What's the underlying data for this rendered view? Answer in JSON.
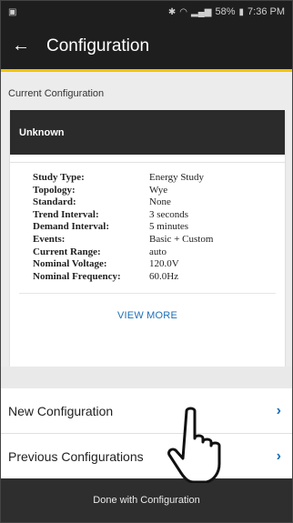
{
  "status_bar": {
    "battery": "58%",
    "time": "7:36 PM"
  },
  "app_bar": {
    "title": "Configuration"
  },
  "current_configuration": {
    "section_label": "Current Configuration",
    "name": "Unknown",
    "properties": [
      {
        "key": "Study Type:",
        "value": "Energy Study"
      },
      {
        "key": "Topology:",
        "value": "Wye"
      },
      {
        "key": "Standard:",
        "value": "None"
      },
      {
        "key": "Trend Interval:",
        "value": "3 seconds"
      },
      {
        "key": "Demand Interval:",
        "value": "5 minutes"
      },
      {
        "key": "Events:",
        "value": "Basic + Custom"
      },
      {
        "key": "Current Range:",
        "value": "auto"
      },
      {
        "key": "Nominal Voltage:",
        "value": "120.0V"
      },
      {
        "key": "Nominal Frequency:",
        "value": "60.0Hz"
      }
    ],
    "view_more_label": "VIEW MORE"
  },
  "menu": {
    "new_configuration": "New Configuration",
    "previous_configurations": "Previous Configurations"
  },
  "footer": {
    "done_label": "Done with Configuration"
  },
  "icons": {
    "back": "arrow-left-icon",
    "chevron": "chevron-right-icon",
    "pointer": "hand-pointer-icon"
  },
  "colors": {
    "app_bar_bg": "#1e1e1e",
    "accent_yellow": "#f2c300",
    "link_blue": "#1a6fb7",
    "card_header_bg": "#2b2b2b",
    "footer_bg": "#2e2e2e"
  }
}
